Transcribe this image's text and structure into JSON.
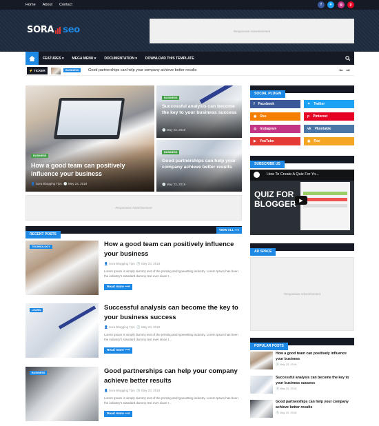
{
  "top_links": [
    "Home",
    "About",
    "Contact"
  ],
  "social_top": [
    "f",
    "t",
    "ig",
    "p"
  ],
  "logo": {
    "sora": "SORA",
    "seo": "seo"
  },
  "ad_label": "Responsive Advertisement",
  "nav": [
    "FEATURES ▾",
    "MEGA MENU ▾",
    "DOCUMENTATION ▾",
    "DOWNLOAD THIS TEMPLATE"
  ],
  "ticker": {
    "label": "TICKER",
    "tag": "BUSINESS",
    "text": "Good partnerships can help your company achieve better results"
  },
  "featured": [
    {
      "tag": "BUSINESS",
      "title": "How a good team can positively influence your business",
      "author": "Sora Blogging Tips",
      "date": "May 23, 2018"
    },
    {
      "tag": "BUSINESS",
      "title": "Successful analysis can become the key to your business success",
      "date": "May 23, 2018"
    },
    {
      "tag": "BUSINESS",
      "title": "Good partnerships can help your company achieve better results",
      "date": "May 23, 2018"
    }
  ],
  "recent": {
    "title": "RECENT POSTS",
    "view_all": "VIEW ALL ⟶"
  },
  "posts": [
    {
      "tag": "TECHNOLOGY",
      "title": "How a good team can positively influence your business",
      "author": "Sora Blogging Tips",
      "date": "May 23, 2018",
      "excerpt": "Lorem Ipsum is simply dummy text of the printing and typesetting industry. Lorem Ipsum has been the industry's standard dummy text ever since t…",
      "read_more": "Read more ⟶"
    },
    {
      "tag": "LEARN",
      "title": "Successful analysis can become the key to your business success",
      "author": "Sora Blogging Tips",
      "date": "May 23, 2018",
      "excerpt": "Lorem Ipsum is simply dummy text of the printing and typesetting industry. Lorem Ipsum has been the industry's standard dummy text ever since t…",
      "read_more": "Read more ⟶"
    },
    {
      "tag": "BUSINESS",
      "title": "Good partnerships can help your company achieve better results",
      "author": "Sora Blogging Tips",
      "date": "May 23, 2018",
      "excerpt": "Lorem Ipsum is simply dummy text of the printing and typesetting industry. Lorem Ipsum has been the industry's standard dummy text ever since t…",
      "read_more": "Read more ⟶"
    }
  ],
  "sidebar": {
    "social_title": "SOCIAL PLUGIN",
    "social": [
      {
        "label": "Facebook",
        "color": "#3b5998"
      },
      {
        "label": "Twitter",
        "color": "#1da1f2"
      },
      {
        "label": "Rss",
        "color": "#f57d00"
      },
      {
        "label": "Pinterest",
        "color": "#e60023"
      },
      {
        "label": "Instagram",
        "color": "#c13584"
      },
      {
        "label": "Vkontakte",
        "color": "#4a76a8"
      },
      {
        "label": "YouTube",
        "color": "#e53935"
      },
      {
        "label": "Rss",
        "color": "#f5a623"
      }
    ],
    "subscribe_title": "SUBSCRIBE US",
    "video_title": "How To Create A Quiz For Yo...",
    "video_overlay": "QUIZ FOR BLOGGER",
    "adspace_title": "AD SPACE",
    "popular_title": "POPULAR POSTS",
    "popular": [
      {
        "title": "How a good team can positively influence your business",
        "date": "May 23, 2018"
      },
      {
        "title": "Successful analysis can become the key to your business success",
        "date": "May 23, 2018"
      },
      {
        "title": "Good partnerships can help your company achieve better results",
        "date": "May 23, 2018"
      }
    ]
  }
}
